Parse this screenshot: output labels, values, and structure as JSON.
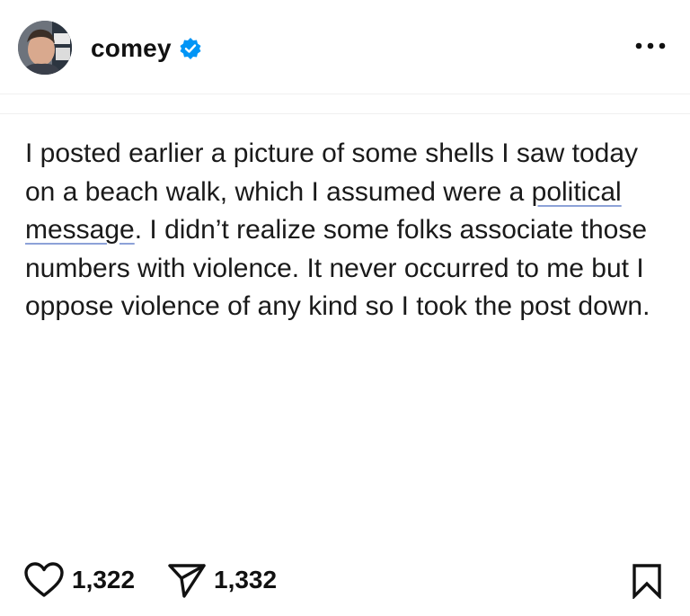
{
  "post": {
    "username": "comey",
    "verified": true,
    "text_segments": {
      "line_part_1": "I posted earlier a picture of some shells I saw today on a beach walk, which I assumed were a ",
      "link_1": "political",
      "space": " ",
      "link_2": "message",
      "line_part_2": ". I didn’t realize some folks associate those numbers with violence. It never occurred to me but I oppose violence of any kind so I took the post down."
    },
    "likes": "1,322",
    "shares": "1,332"
  },
  "icons": {
    "avatar": "profile-photo",
    "verified": "verified-badge-icon",
    "more": "more-options-icon",
    "like": "heart-icon",
    "share": "paper-plane-icon",
    "save": "bookmark-icon"
  },
  "colors": {
    "verified_blue": "#0095f6",
    "link_underline": "#8da2d8",
    "text": "#1a1a1a"
  }
}
